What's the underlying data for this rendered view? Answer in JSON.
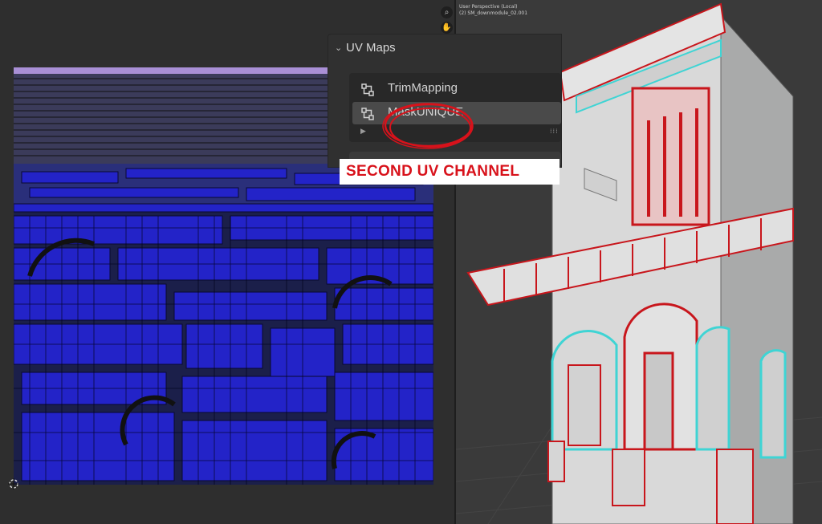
{
  "viewport": {
    "header_line1": "User Perspective (Local)",
    "header_line2": "(2) SM_downmodule_02.001",
    "zoom_icon": "magnifier-icon",
    "pan_icon": "hand-icon"
  },
  "uv_panel": {
    "title": "UV Maps",
    "items": [
      {
        "label": "TrimMapping",
        "selected": false
      },
      {
        "label": "MaskUNIQUE",
        "selected": true
      }
    ]
  },
  "annotation": {
    "text": "SECOND UV CHANNEL",
    "color": "#d8121b"
  },
  "colors": {
    "uv_fill": "#1f1fd0",
    "wire_red": "#c8161c",
    "wire_cyan": "#3fd4d4"
  }
}
